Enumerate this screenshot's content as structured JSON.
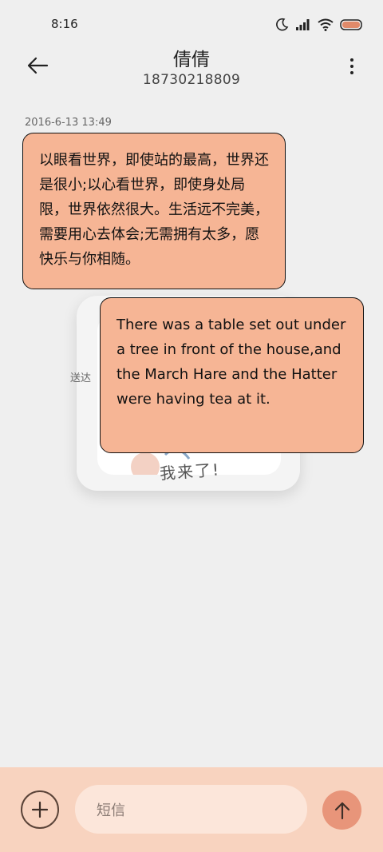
{
  "status_bar": {
    "time": "8:16",
    "icons": [
      "moon-icon",
      "signal-icon",
      "wifi-icon",
      "battery-icon"
    ]
  },
  "header": {
    "contact_name": "倩倩",
    "phone_number": "18730218809"
  },
  "conversation": {
    "timestamp": "2016-6-13 13:49",
    "messages": [
      {
        "text": "以眼看世界，即使站的最高，世界还是很小;以心看世界，即使身处局限，世界依然很大。生活远不完美，需要用心去体会;无需拥有太多，愿快乐与你相随。"
      },
      {
        "text": "There was a table set out under a tree in front of the house,and the March Hare and the Hatter were having tea at it."
      }
    ],
    "delivered_label": "送达",
    "sticker_caption": "我来了!"
  },
  "composer": {
    "placeholder": "短信"
  },
  "colors": {
    "bubble": "#f6b595",
    "bottom_bar": "#f8d3bf",
    "send_button": "#e8957a"
  }
}
